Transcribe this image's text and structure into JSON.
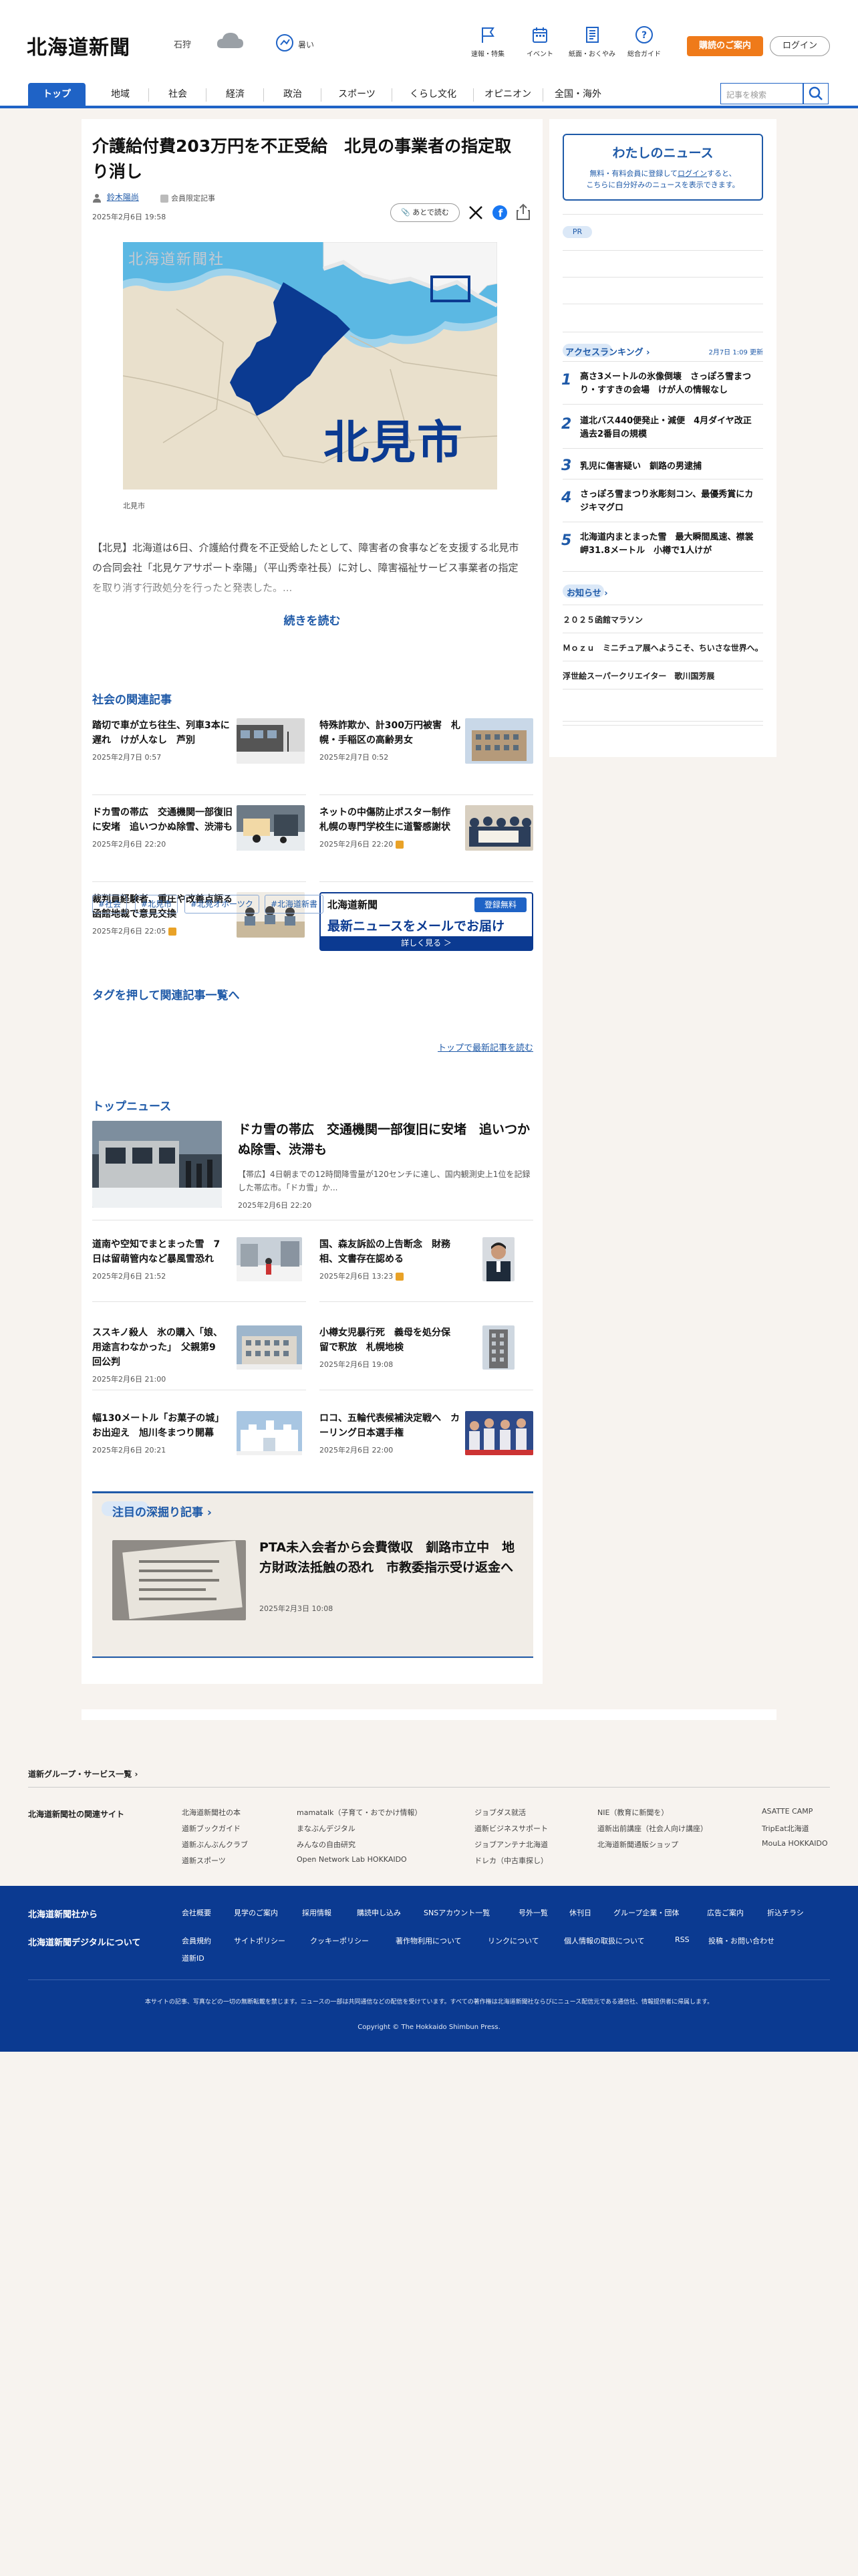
{
  "header": {
    "logo": "北海道新聞",
    "weather_region": "石狩",
    "heat_label": "暑い",
    "nav_icons": [
      {
        "label": "速報・特集",
        "icon": "flag-icon"
      },
      {
        "label": "イベント",
        "icon": "calendar-icon"
      },
      {
        "label": "紙面・おくやみ",
        "icon": "newspaper-icon"
      },
      {
        "label": "総合ガイド",
        "icon": "help-icon"
      }
    ],
    "guide_button": "購読のご案内",
    "login_button": "ログイン",
    "search_placeholder": "記事を検索"
  },
  "nav": {
    "tabs": [
      "トップ",
      "地域",
      "社会",
      "経済",
      "政治",
      "スポーツ",
      "くらし文化",
      "オピニオン",
      "全国・海外"
    ]
  },
  "article": {
    "title": "介護給付費203万円を不正受給　北見の事業者の指定取り消し",
    "author": "鈴木陽尚",
    "member_label": "会員限定記事",
    "date": "2025年2月6日 19:58",
    "save_label": "あとで読む",
    "photo_text": "北見市",
    "photo_logo": "北海道新聞社",
    "caption": "北見市",
    "lead": "【北見】北海道は6日、介護給付費を不正受給したとして、障害者の食事などを支援する北見市の合同会社「北見ケアサポート幸陽」（平山秀幸社長）に対し、障害福祉サービス事業者の指定を取り消す行政処分を行ったと発表した。...",
    "read_more": "続きを読む"
  },
  "related": {
    "heading": "社会の関連記事",
    "items": [
      {
        "title": "踏切で車が立ち往生、列車3本に遅れ　けが人なし　芦別",
        "date": "2025年2月7日 0:57",
        "locked": false
      },
      {
        "title": "特殊詐欺か、計300万円被害　札幌・手稲区の高齢男女",
        "date": "2025年2月7日 0:52",
        "locked": false
      },
      {
        "title": "ドカ雪の帯広　交通機関一部復旧に安堵　追いつかぬ除雪、渋滞も",
        "date": "2025年2月6日 22:20",
        "locked": false
      },
      {
        "title": "ネットの中傷防止ポスター制作　札幌の専門学校生に道警感謝状",
        "date": "2025年2月6日 22:20",
        "locked": true
      },
      {
        "title": "裁判員経験者、重圧や改善点語る　函館地裁で意見交換",
        "date": "2025年2月6日 22:05",
        "locked": true
      }
    ],
    "banner": {
      "logo": "北海道新聞",
      "badge": "登録無料",
      "main": "最新ニュースをメールでお届け",
      "button": "詳しく見る ＞"
    }
  },
  "tags": {
    "heading": "タグを押して関連記事一覧へ",
    "items": [
      "#社会",
      "#北見市",
      "#北見オホーツク",
      "#北海道新書"
    ],
    "more_link": "トップで最新記事を読む"
  },
  "top_news": {
    "heading": "トップニュース",
    "main": {
      "title": "ドカ雪の帯広　交通機関一部復旧に安堵　追いつかぬ除雪、渋滞も",
      "summary": "【帯広】4日朝までの12時間降雪量が120センチに達し、国内観測史上1位を記録した帯広市。「ドカ雪」か...",
      "date": "2025年2月6日 22:20"
    },
    "items": [
      {
        "title": "道南や空知でまとまった雪　7日は留萌管内など暴風雪恐れ",
        "date": "2025年2月6日 21:52",
        "locked": false
      },
      {
        "title": "国、森友訴訟の上告断念　財務相、文書存在認める",
        "date": "2025年2月6日 13:23",
        "locked": true
      },
      {
        "title": "ススキノ殺人　氷の購入「娘、用途言わなかった」　父親第9回公判",
        "date": "2025年2月6日 21:00",
        "locked": false
      },
      {
        "title": "小樽女児暴行死　義母を処分保留で釈放　札幌地検",
        "date": "2025年2月6日 19:08",
        "locked": false
      },
      {
        "title": "幅130メートル「お菓子の城」お出迎え　旭川冬まつり開幕",
        "date": "2025年2月6日 20:21",
        "locked": false
      },
      {
        "title": "ロコ、五輪代表候補決定戦へ　カーリング日本選手権",
        "date": "2025年2月6日 22:00",
        "locked": false
      }
    ]
  },
  "feature": {
    "heading": "注目の深掘り記事",
    "title": "PTA未入会者から会費徴収　釧路市立中　地方財政法抵触の恐れ　市教委指示受け返金へ",
    "date": "2025年2月3日 10:08"
  },
  "sidebar": {
    "my_news_title": "わたしのニュース",
    "my_news_text_1": "無料・有料会員に登録して",
    "my_news_login": "ログイン",
    "my_news_text_2": "すると、",
    "my_news_text_3": "こちらに自分好みのニュースを表示できます。",
    "pr_label": "PR",
    "ranking_heading": "アクセスランキング",
    "ranking_updated": "2月7日 1:09 更新",
    "ranking": [
      {
        "rank": "1",
        "title": "高さ3メートルの氷像倒壊　さっぽろ雪まつり・すすきの会場　けが人の情報なし"
      },
      {
        "rank": "2",
        "title": "道北バス440便発止・減便　4月ダイヤ改正　過去2番目の規模"
      },
      {
        "rank": "3",
        "title": "乳児に傷害疑い　釧路の男逮捕"
      },
      {
        "rank": "4",
        "title": "さっぽろ雪まつり氷彫刻コン、最優秀賞にカジキマグロ"
      },
      {
        "rank": "5",
        "title": "北海道内まとまった雪　最大瞬間風速、襟裳岬31.8メートル　小樽で1人けが"
      }
    ],
    "notice_heading": "お知らせ",
    "notices": [
      "２０２５函館マラソン",
      "Ｍｏｚｕ　ミニチュア展へようこそ、ちいさな世界へ。",
      "浮世絵スーパークリエイター　歌川国芳展"
    ]
  },
  "footer": {
    "group_heading": "道新グループ・サービス一覧",
    "related_heading": "北海道新聞社の関連サイト",
    "related_sites": [
      [
        "北海道新聞社の本",
        "道新ブックガイド",
        "道新ぶんぶんクラブ",
        "道新スポーツ"
      ],
      [
        "mamatalk（子育て・おでかけ情報）",
        "まなぶんデジタル",
        "みんなの自由研究",
        "Open Network Lab HOKKAIDO"
      ],
      [
        "ジョブダス就活",
        "道新ビジネスサポート",
        "ジョブアンテナ北海道",
        "ドレカ（中古車探し）"
      ],
      [
        "NIE（教育に新聞を）",
        "道新出前講座（社会人向け講座）",
        "北海道新聞通販ショップ"
      ],
      [
        "ASATTE CAMP",
        "TripEat北海道",
        "MouLa HOKKAIDO"
      ]
    ],
    "about_heading": "北海道新聞社から",
    "digital_heading": "北海道新聞デジタルについて",
    "about_links": [
      "会社概要",
      "見学のご案内",
      "採用情報",
      "購読申し込み",
      "SNSアカウント一覧",
      "号外一覧",
      "休刊日",
      "グループ企業・団体",
      "広告ご案内",
      "折込チラシ"
    ],
    "digital_links": [
      "会員規約",
      "サイトポリシー",
      "クッキーポリシー",
      "著作物利用について",
      "リンクについて",
      "個人情報の取扱について",
      "RSS",
      "投稿・お問い合わせ",
      "道新ID"
    ],
    "notice": "本サイトの記事、写真などの一切の無断転載を禁じます。ニュースの一部は共同通信などの配信を受けています。すべての著作権は北海道新聞社ならびにニュース配信元である通信社、情報提供者に帰属します。",
    "copyright": "Copyright © The Hokkaido Shimbun Press."
  }
}
